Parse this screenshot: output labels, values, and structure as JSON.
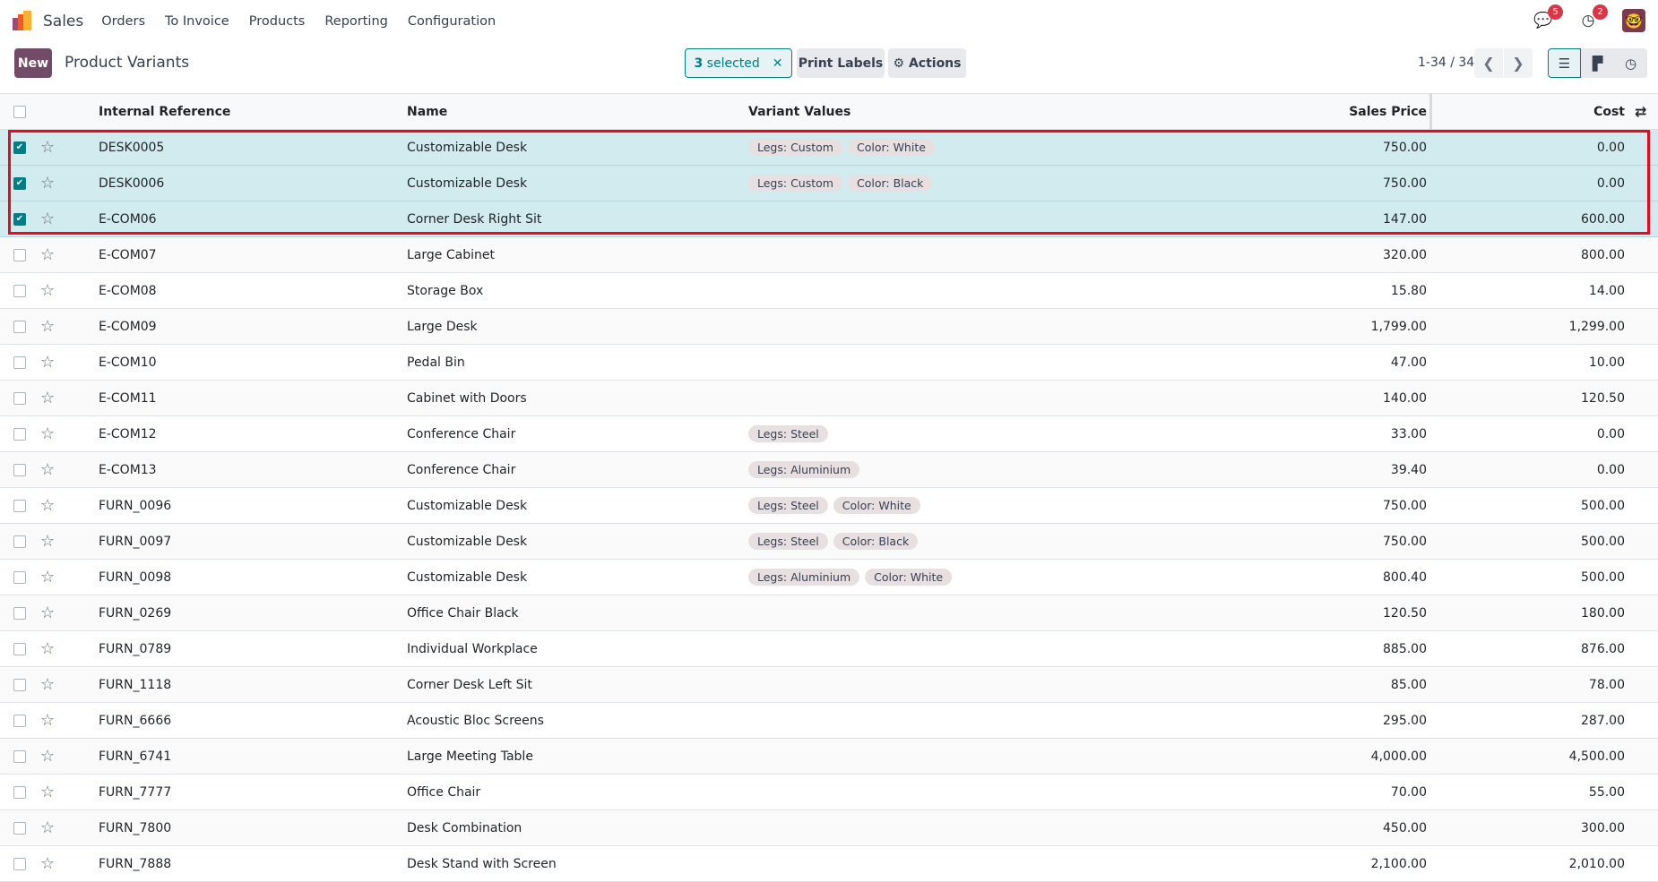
{
  "nav": {
    "app": "Sales",
    "menu": [
      "Orders",
      "To Invoice",
      "Products",
      "Reporting",
      "Configuration"
    ],
    "messages_badge": "5",
    "activities_badge": "2"
  },
  "control": {
    "new_label": "New",
    "title": "Product Variants",
    "selected_count": "3",
    "selected_label": "selected",
    "print_labels": "Print Labels",
    "actions": "Actions",
    "pager": "1-34 / 34"
  },
  "colors": {
    "brand": "#714b67",
    "accent": "#017e84",
    "highlight": "#e8091a"
  },
  "table": {
    "headers": {
      "ref": "Internal Reference",
      "name": "Name",
      "variants": "Variant Values",
      "price": "Sales Price",
      "cost": "Cost"
    },
    "rows": [
      {
        "selected": true,
        "ref": "DESK0005",
        "name": "Customizable Desk",
        "tags": [
          "Legs: Custom",
          "Color: White"
        ],
        "price": "750.00",
        "cost": "0.00"
      },
      {
        "selected": true,
        "ref": "DESK0006",
        "name": "Customizable Desk",
        "tags": [
          "Legs: Custom",
          "Color: Black"
        ],
        "price": "750.00",
        "cost": "0.00"
      },
      {
        "selected": true,
        "ref": "E-COM06",
        "name": "Corner Desk Right Sit",
        "tags": [],
        "price": "147.00",
        "cost": "600.00"
      },
      {
        "selected": false,
        "ref": "E-COM07",
        "name": "Large Cabinet",
        "tags": [],
        "price": "320.00",
        "cost": "800.00"
      },
      {
        "selected": false,
        "ref": "E-COM08",
        "name": "Storage Box",
        "tags": [],
        "price": "15.80",
        "cost": "14.00"
      },
      {
        "selected": false,
        "ref": "E-COM09",
        "name": "Large Desk",
        "tags": [],
        "price": "1,799.00",
        "cost": "1,299.00"
      },
      {
        "selected": false,
        "ref": "E-COM10",
        "name": "Pedal Bin",
        "tags": [],
        "price": "47.00",
        "cost": "10.00"
      },
      {
        "selected": false,
        "ref": "E-COM11",
        "name": "Cabinet with Doors",
        "tags": [],
        "price": "140.00",
        "cost": "120.50"
      },
      {
        "selected": false,
        "ref": "E-COM12",
        "name": "Conference Chair",
        "tags": [
          "Legs: Steel"
        ],
        "price": "33.00",
        "cost": "0.00"
      },
      {
        "selected": false,
        "ref": "E-COM13",
        "name": "Conference Chair",
        "tags": [
          "Legs: Aluminium"
        ],
        "price": "39.40",
        "cost": "0.00"
      },
      {
        "selected": false,
        "ref": "FURN_0096",
        "name": "Customizable Desk",
        "tags": [
          "Legs: Steel",
          "Color: White"
        ],
        "price": "750.00",
        "cost": "500.00"
      },
      {
        "selected": false,
        "ref": "FURN_0097",
        "name": "Customizable Desk",
        "tags": [
          "Legs: Steel",
          "Color: Black"
        ],
        "price": "750.00",
        "cost": "500.00"
      },
      {
        "selected": false,
        "ref": "FURN_0098",
        "name": "Customizable Desk",
        "tags": [
          "Legs: Aluminium",
          "Color: White"
        ],
        "price": "800.40",
        "cost": "500.00"
      },
      {
        "selected": false,
        "ref": "FURN_0269",
        "name": "Office Chair Black",
        "tags": [],
        "price": "120.50",
        "cost": "180.00"
      },
      {
        "selected": false,
        "ref": "FURN_0789",
        "name": "Individual Workplace",
        "tags": [],
        "price": "885.00",
        "cost": "876.00"
      },
      {
        "selected": false,
        "ref": "FURN_1118",
        "name": "Corner Desk Left Sit",
        "tags": [],
        "price": "85.00",
        "cost": "78.00"
      },
      {
        "selected": false,
        "ref": "FURN_6666",
        "name": "Acoustic Bloc Screens",
        "tags": [],
        "price": "295.00",
        "cost": "287.00"
      },
      {
        "selected": false,
        "ref": "FURN_6741",
        "name": "Large Meeting Table",
        "tags": [],
        "price": "4,000.00",
        "cost": "4,500.00"
      },
      {
        "selected": false,
        "ref": "FURN_7777",
        "name": "Office Chair",
        "tags": [],
        "price": "70.00",
        "cost": "55.00"
      },
      {
        "selected": false,
        "ref": "FURN_7800",
        "name": "Desk Combination",
        "tags": [],
        "price": "450.00",
        "cost": "300.00"
      },
      {
        "selected": false,
        "ref": "FURN_7888",
        "name": "Desk Stand with Screen",
        "tags": [],
        "price": "2,100.00",
        "cost": "2,010.00"
      }
    ]
  }
}
